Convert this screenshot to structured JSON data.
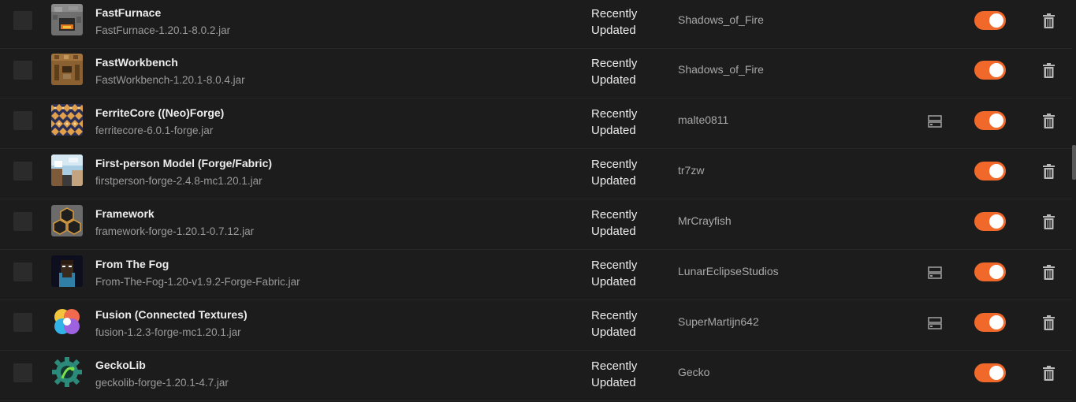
{
  "accent_color": "#f1692a",
  "mods": [
    {
      "name": "FastFurnace",
      "file": "FastFurnace-1.20.1-8.0.2.jar",
      "status_line1": "Recently",
      "status_line2": "Updated",
      "author": "Shadows_of_Fire",
      "server_icon": false,
      "enabled": true,
      "icon": "furnace-icon"
    },
    {
      "name": "FastWorkbench",
      "file": "FastWorkbench-1.20.1-8.0.4.jar",
      "status_line1": "Recently",
      "status_line2": "Updated",
      "author": "Shadows_of_Fire",
      "server_icon": false,
      "enabled": true,
      "icon": "workbench-icon"
    },
    {
      "name": "FerriteCore ((Neo)Forge)",
      "file": "ferritecore-6.0.1-forge.jar",
      "status_line1": "Recently",
      "status_line2": "Updated",
      "author": "malte0811",
      "server_icon": true,
      "enabled": true,
      "icon": "ferritecore-icon"
    },
    {
      "name": "First-person Model (Forge/Fabric)",
      "file": "firstperson-forge-2.4.8-mc1.20.1.jar",
      "status_line1": "Recently",
      "status_line2": "Updated",
      "author": "tr7zw",
      "server_icon": false,
      "enabled": true,
      "icon": "firstperson-icon"
    },
    {
      "name": "Framework",
      "file": "framework-forge-1.20.1-0.7.12.jar",
      "status_line1": "Recently",
      "status_line2": "Updated",
      "author": "MrCrayfish",
      "server_icon": false,
      "enabled": true,
      "icon": "framework-icon"
    },
    {
      "name": "From The Fog",
      "file": "From-The-Fog-1.20-v1.9.2-Forge-Fabric.jar",
      "status_line1": "Recently",
      "status_line2": "Updated",
      "author": "LunarEclipseStudios",
      "server_icon": true,
      "enabled": true,
      "icon": "herobrine-icon"
    },
    {
      "name": "Fusion (Connected Textures)",
      "file": "fusion-1.2.3-forge-mc1.20.1.jar",
      "status_line1": "Recently",
      "status_line2": "Updated",
      "author": "SuperMartijn642",
      "server_icon": true,
      "enabled": true,
      "icon": "fusion-icon"
    },
    {
      "name": "GeckoLib",
      "file": "geckolib-forge-1.20.1-4.7.jar",
      "status_line1": "Recently",
      "status_line2": "Updated",
      "author": "Gecko",
      "server_icon": false,
      "enabled": true,
      "icon": "geckolib-icon"
    }
  ]
}
